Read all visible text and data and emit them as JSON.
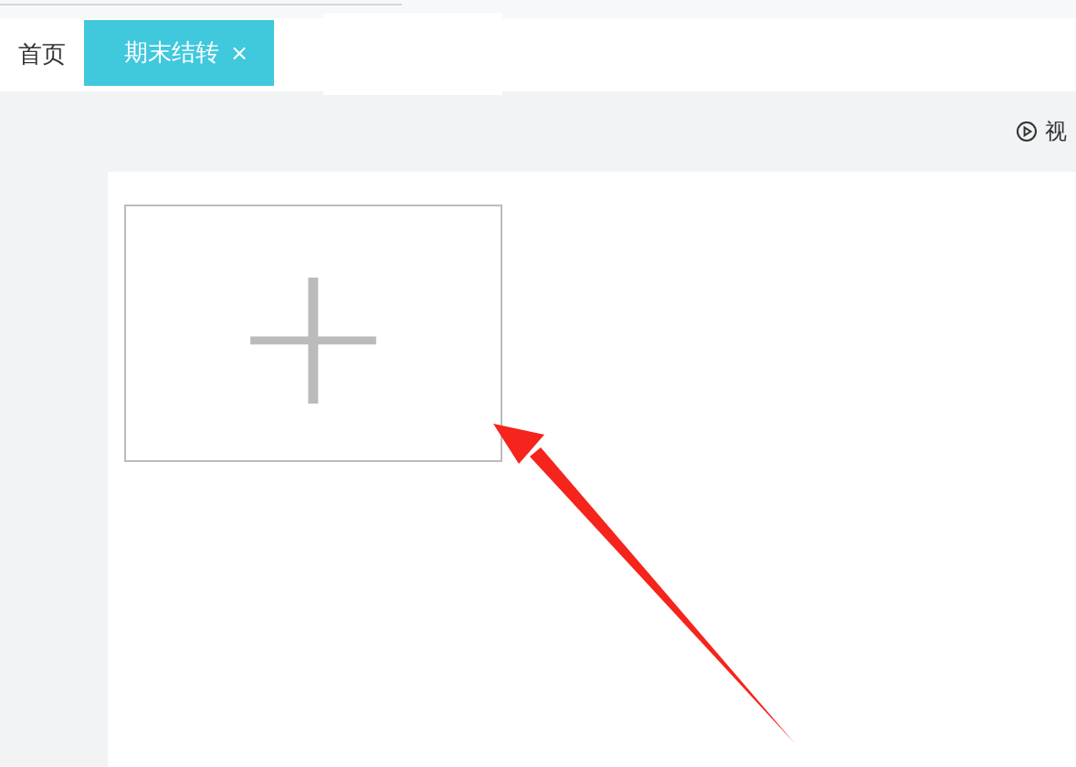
{
  "tabs": [
    {
      "label": "首页",
      "selected": false
    },
    {
      "label": "期末结转",
      "selected": true,
      "close": "×"
    }
  ],
  "video_link": {
    "label": "视"
  },
  "upload": {
    "symbol": "+"
  }
}
